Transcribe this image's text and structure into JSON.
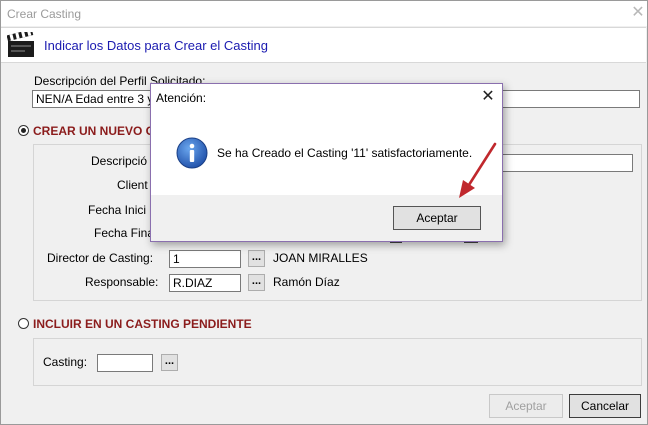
{
  "window": {
    "title": "Crear Casting"
  },
  "header": {
    "title": "Indicar los Datos para Crear el Casting"
  },
  "perfil": {
    "label": "Descripción del Perfil Solicitado:",
    "value": "NEN/A Edad entre 3 y 6"
  },
  "crear": {
    "title": "CREAR UN NUEVO C",
    "descripcion_label": "Descripció",
    "cliente_label": "Client",
    "fecha_inicio_label": "Fecha Inici",
    "fecha_fin_label": "Fecha Fina",
    "director_label": "Director de Casting:",
    "director_value": "1",
    "director_name": "JOAN MIRALLES",
    "responsable_label": "Responsable:",
    "responsable_value": "R.DIAZ",
    "responsable_name": "Ramón Díaz",
    "browse": "..."
  },
  "incluir": {
    "title": "INCLUIR EN UN CASTING PENDIENTE",
    "casting_label": "Casting:",
    "casting_value": "",
    "browse": "..."
  },
  "buttons": {
    "aceptar": "Aceptar",
    "cancelar": "Cancelar"
  },
  "dialog": {
    "title": "Atención:",
    "message": "Se ha Creado el Casting '11' satisfactoriamente.",
    "ok": "Aceptar",
    "close": "✕"
  },
  "colors": {
    "section": "#8b1c1c",
    "header": "#1a1ab0",
    "arrow": "#c0282d",
    "dialog_border": "#8a6fae"
  }
}
